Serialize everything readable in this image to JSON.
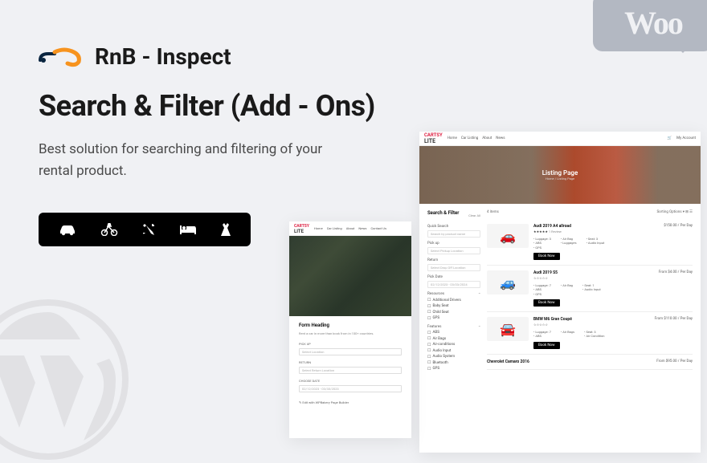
{
  "brand": "RnB - Inspect",
  "title": "Search & Filter (Add - Ons)",
  "subtitle": "Best solution for searching and filtering of your rental product.",
  "woo": "Woo",
  "mockA": {
    "logo": "CARTSY LITE",
    "nav": [
      "Home",
      "Car Listing",
      "About",
      "News",
      "Contact Us"
    ],
    "formHeading": "Form Heading",
    "formSub": "Rent a car in more than book from in 100+ countries.",
    "pickup": "PICK UP",
    "pickupPlaceholder": "Select Location",
    "return": "RETURN",
    "returnPlaceholder": "Select Return Location",
    "chooseDate": "CHOOSE DATE",
    "dateRange": "02/12/2023 - 03/30/2023",
    "note": "Edit with WPBakery Page Builder"
  },
  "mockB": {
    "logo": "CARTSY LITE",
    "nav": [
      "Home",
      "Car Listing",
      "About",
      "News"
    ],
    "account": "My Account",
    "heroTitle": "Listing Page",
    "heroBreadcrumb": "Home / Listing Page",
    "sidebar": {
      "title": "Search & Filter",
      "clear": "Clear All",
      "quickSearch": "Quick Search",
      "quickSearchPlaceholder": "Search by product name",
      "pickup": "Pick up",
      "pickupPlaceholder": "Select Pickup Location",
      "return": "Return",
      "returnPlaceholder": "Select Drop Off Location",
      "pickDate": "Pick Date",
      "datePlaceholder": "02/12/2023 - 03/03/2024",
      "resources": "Resources",
      "resourceItems": [
        "Additional Drivers",
        "Baby Seat",
        "Child Seat",
        "GPS"
      ],
      "features": "Features",
      "featureItems": [
        "ABS",
        "Air Bags",
        "Air-conditions",
        "Audio Input",
        "Audio System",
        "Bluetooth",
        "GPS"
      ]
    },
    "results": {
      "count": "4 items",
      "sortLabel": "Sorting Options",
      "items": [
        {
          "name": "Audi 2019 A4 allroad",
          "price": "$150.00 / Per Day",
          "stars": "★★★★★",
          "review": "1 Review",
          "specs": [
            [
              "Luggage: 3",
              "ABS",
              "GPS"
            ],
            [
              "Air Bag",
              "Luggages"
            ],
            [
              "Seat: 3",
              "Audio Input"
            ]
          ],
          "car": "🚗"
        },
        {
          "name": "Audi 2019 S5",
          "price": "From $4.00 / Per Day",
          "stars": "☆☆☆☆☆",
          "specs": [
            [
              "Luggage: 7",
              "ABS",
              "GPS"
            ],
            [
              "Air Bag"
            ],
            [
              "Seat: 1",
              "Audio Input"
            ]
          ],
          "car": "🚙"
        },
        {
          "name": "BMW M6 Gran Coupé",
          "price": "From $110.00 / Per Day",
          "stars": "☆☆☆☆☆",
          "specs": [
            [
              "Luggage: 7",
              "ABS"
            ],
            [
              "Air Bags"
            ],
            [
              "Seat: 3",
              "Air Condition"
            ]
          ],
          "car": "🚘"
        },
        {
          "name": "Chevrolet Camaro 2016",
          "price": "From $95.00 / Per Day"
        }
      ],
      "bookBtn": "Book Now"
    }
  }
}
